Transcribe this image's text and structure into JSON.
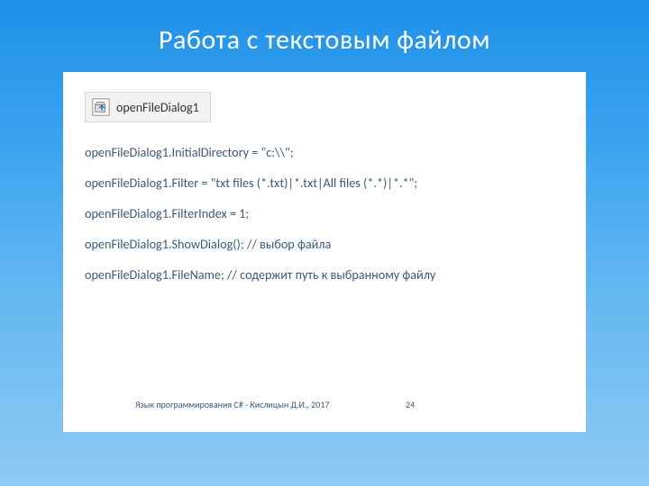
{
  "title": "Работа с текстовым файлом",
  "control": {
    "icon": "open-file-dialog-icon",
    "label": "openFileDialog1"
  },
  "code": [
    "openFileDialog1.InitialDirectory = \"c:\\\\\";",
    "openFileDialog1.Filter = \"txt files (*.txt)|*.txt|All files (*.*)|*.*\";",
    "openFileDialog1.FilterIndex = 1;",
    "openFileDialog1.ShowDialog(); // выбор файла",
    "openFileDialog1.FileName; // содержит путь к выбранному файлу"
  ],
  "footer": {
    "left": "Язык программирования C# - Кислицын Д.И., 2017",
    "page": "24"
  }
}
